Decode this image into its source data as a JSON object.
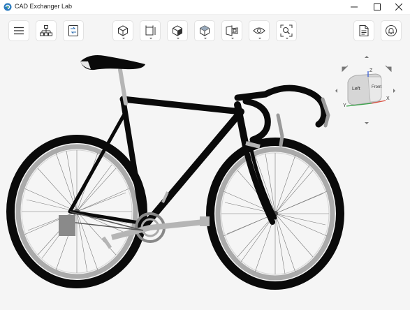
{
  "window": {
    "title": "CAD Exchanger Lab",
    "minimize_glyph": "—",
    "maximize_glyph": "☐",
    "close_glyph": "✕"
  },
  "toolbar": {
    "left": [
      {
        "icon": "menu-icon"
      },
      {
        "icon": "model-tree-icon"
      },
      {
        "icon": "properties-icon"
      }
    ],
    "center": [
      {
        "icon": "display-mode-icon"
      },
      {
        "icon": "clipping-plane-icon"
      },
      {
        "icon": "shading-icon"
      },
      {
        "icon": "view-orientation-icon"
      },
      {
        "icon": "projection-icon"
      },
      {
        "icon": "visibility-icon"
      },
      {
        "icon": "zoom-fit-icon"
      }
    ],
    "right": [
      {
        "icon": "document-icon"
      },
      {
        "icon": "notifications-icon"
      }
    ]
  },
  "nav_cube": {
    "face_left": "Left",
    "face_front": "Front",
    "axis_x": "X",
    "axis_y": "Y",
    "axis_z": "Z",
    "colors": {
      "x_axis": "#d94a3b",
      "y_axis": "#3aa34a",
      "z_axis": "#3a5fd9"
    }
  },
  "model": {
    "name": "bicycle-model"
  },
  "colors": {
    "accent": "#2b6cb0",
    "viewport": "#f5f5f5",
    "frame": "#0a0a0a",
    "metal": "#b5b5b5"
  }
}
